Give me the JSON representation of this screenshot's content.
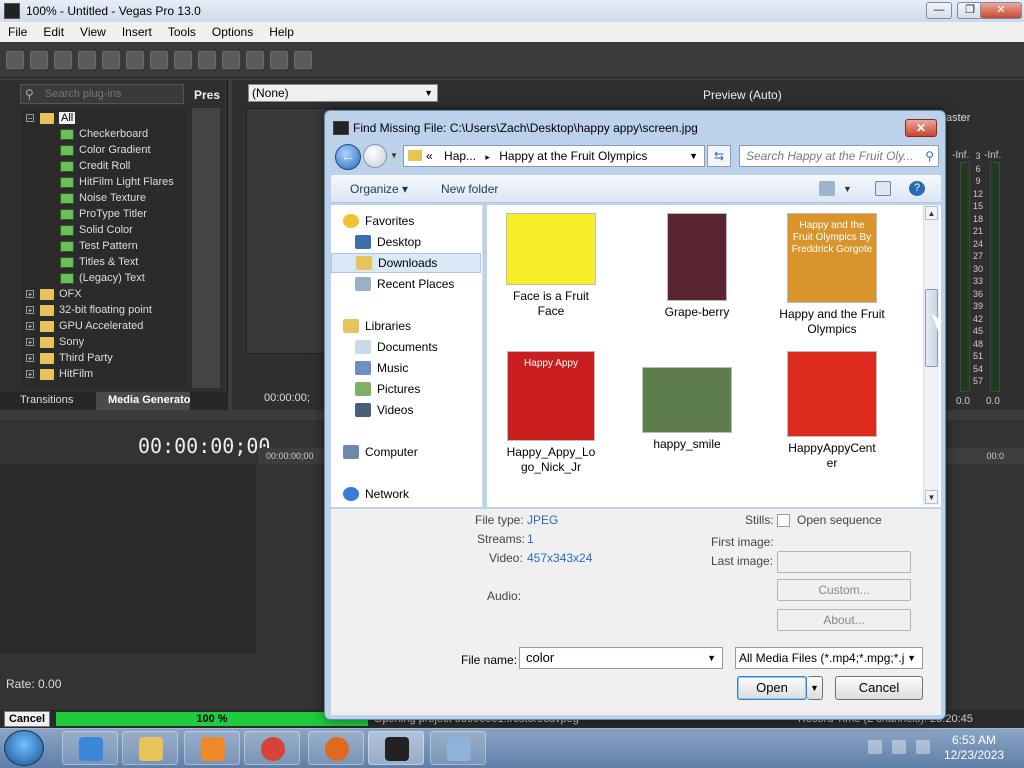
{
  "window": {
    "title": "100% - Untitled - Vegas Pro 13.0",
    "controls": {
      "minimize": "—",
      "maximize": "❐",
      "close": "✕"
    }
  },
  "menu": [
    "File",
    "Edit",
    "View",
    "Insert",
    "Tools",
    "Options",
    "Help"
  ],
  "plugins": {
    "search_placeholder": "Search plug-ins",
    "presets_header": "Pres",
    "tree": [
      {
        "label": "All",
        "type": "folder",
        "level": 0,
        "expander": "−"
      },
      {
        "label": "Checkerboard",
        "type": "plugin",
        "level": 1
      },
      {
        "label": "Color Gradient",
        "type": "plugin",
        "level": 1
      },
      {
        "label": "Credit Roll",
        "type": "plugin",
        "level": 1
      },
      {
        "label": "HitFilm Light Flares",
        "type": "plugin",
        "level": 1
      },
      {
        "label": "Noise Texture",
        "type": "plugin",
        "level": 1
      },
      {
        "label": "ProType Titler",
        "type": "plugin",
        "level": 1
      },
      {
        "label": "Solid Color",
        "type": "plugin",
        "level": 1
      },
      {
        "label": "Test Pattern",
        "type": "plugin",
        "level": 1
      },
      {
        "label": "Titles & Text",
        "type": "plugin",
        "level": 1
      },
      {
        "label": "(Legacy) Text",
        "type": "plugin",
        "level": 1
      },
      {
        "label": "OFX",
        "type": "folder",
        "level": 0,
        "expander": "+"
      },
      {
        "label": "32-bit floating point",
        "type": "folder",
        "level": 0,
        "expander": "+"
      },
      {
        "label": "GPU Accelerated",
        "type": "folder",
        "level": 0,
        "expander": "+"
      },
      {
        "label": "Sony",
        "type": "folder",
        "level": 0,
        "expander": "+"
      },
      {
        "label": "Third Party",
        "type": "folder",
        "level": 0,
        "expander": "+"
      },
      {
        "label": "HitFilm",
        "type": "folder",
        "level": 0,
        "expander": "+"
      }
    ],
    "tabs": [
      "Transitions",
      "Media Generators"
    ]
  },
  "preview": {
    "fx_select": "(None)",
    "label": "Preview (Auto)",
    "time_small": "00:00:00;"
  },
  "mixer": {
    "master": "aster",
    "inf_left": "-Inf.",
    "inf_right": "-Inf.",
    "levels": [
      "3",
      "6",
      "9",
      "12",
      "15",
      "18",
      "21",
      "24",
      "27",
      "30",
      "33",
      "36",
      "39",
      "42",
      "45",
      "48",
      "51",
      "54",
      "57"
    ],
    "zero_left": "0.0",
    "zero_right": "0.0"
  },
  "timeline": {
    "timecode": "00:00:00;00",
    "ruler_start": "00:00:00;00",
    "ruler_right": "00:0",
    "rate": "Rate: 0.00"
  },
  "status": {
    "cancel": "Cancel",
    "progress_label": "100 %",
    "progress_value": 1.0,
    "message": "Opening project 00000001.frcstorecavpeg",
    "record_time": "Record Time (2 channels): 23:20:45"
  },
  "dialog": {
    "title": "Find Missing File: C:\\Users\\Zach\\Desktop\\happy appy\\screen.jpg",
    "close": "✕",
    "breadcrumb": [
      "«",
      "Hap...",
      "▸",
      "Happy at the Fruit Olympics"
    ],
    "search_placeholder": "Search Happy at the Fruit Oly...",
    "organize": "Organize ▾",
    "new_folder": "New folder",
    "help": "?",
    "nav": [
      {
        "label": "Favorites",
        "kind": "star-icon",
        "indent": 0
      },
      {
        "label": "Desktop",
        "kind": "desktop-icon",
        "indent": 1
      },
      {
        "label": "Downloads",
        "kind": "downloads-icon",
        "indent": 1,
        "selected": true
      },
      {
        "label": "Recent Places",
        "kind": "recent-places-icon",
        "indent": 1
      },
      {
        "label": "Libraries",
        "kind": "libraries-icon",
        "indent": 0
      },
      {
        "label": "Documents",
        "kind": "documents-icon",
        "indent": 1
      },
      {
        "label": "Music",
        "kind": "music-icon",
        "indent": 1
      },
      {
        "label": "Pictures",
        "kind": "pictures-icon",
        "indent": 1
      },
      {
        "label": "Videos",
        "kind": "videos-icon",
        "indent": 1
      },
      {
        "label": "Computer",
        "kind": "computer-icon",
        "indent": 0
      },
      {
        "label": "Network",
        "kind": "network-icon",
        "indent": 0
      }
    ],
    "files": [
      {
        "name": "Face is a Fruit Face",
        "thumb": "#f7ee2a"
      },
      {
        "name": "Grape-berry",
        "thumb": "#5a2430"
      },
      {
        "name": "Happy and the Fruit Olympics",
        "thumb": "#d9942c",
        "thumb_text": "Happy and the Fruit Olympics By Freddrick Gorgote"
      },
      {
        "name": "Happy_Appy_Logo_Nick_Jr",
        "thumb": "#c81e1e",
        "thumb_text": "Happy Appy"
      },
      {
        "name": "happy_smile",
        "thumb": "#5d7d4c"
      },
      {
        "name": "HappyAppyCenter",
        "thumb": "#dd2a1e"
      }
    ],
    "details": {
      "file_type_label": "File type:",
      "file_type": "JPEG",
      "streams_label": "Streams:",
      "streams": "1",
      "video_label": "Video:",
      "video": "457x343x24",
      "audio_label": "Audio:",
      "stills_label": "Stills:",
      "open_sequence": "Open sequence",
      "first_image_label": "First image:",
      "last_image_label": "Last image:",
      "custom": "Custom...",
      "about": "About..."
    },
    "filename_label": "File name:",
    "filename_value": "color",
    "filter": "All Media Files (*.mp4;*.mpg;*.j",
    "open": "Open",
    "cancel": "Cancel"
  },
  "taskbar": {
    "time": "6:53 AM",
    "date": "12/23/2023"
  }
}
